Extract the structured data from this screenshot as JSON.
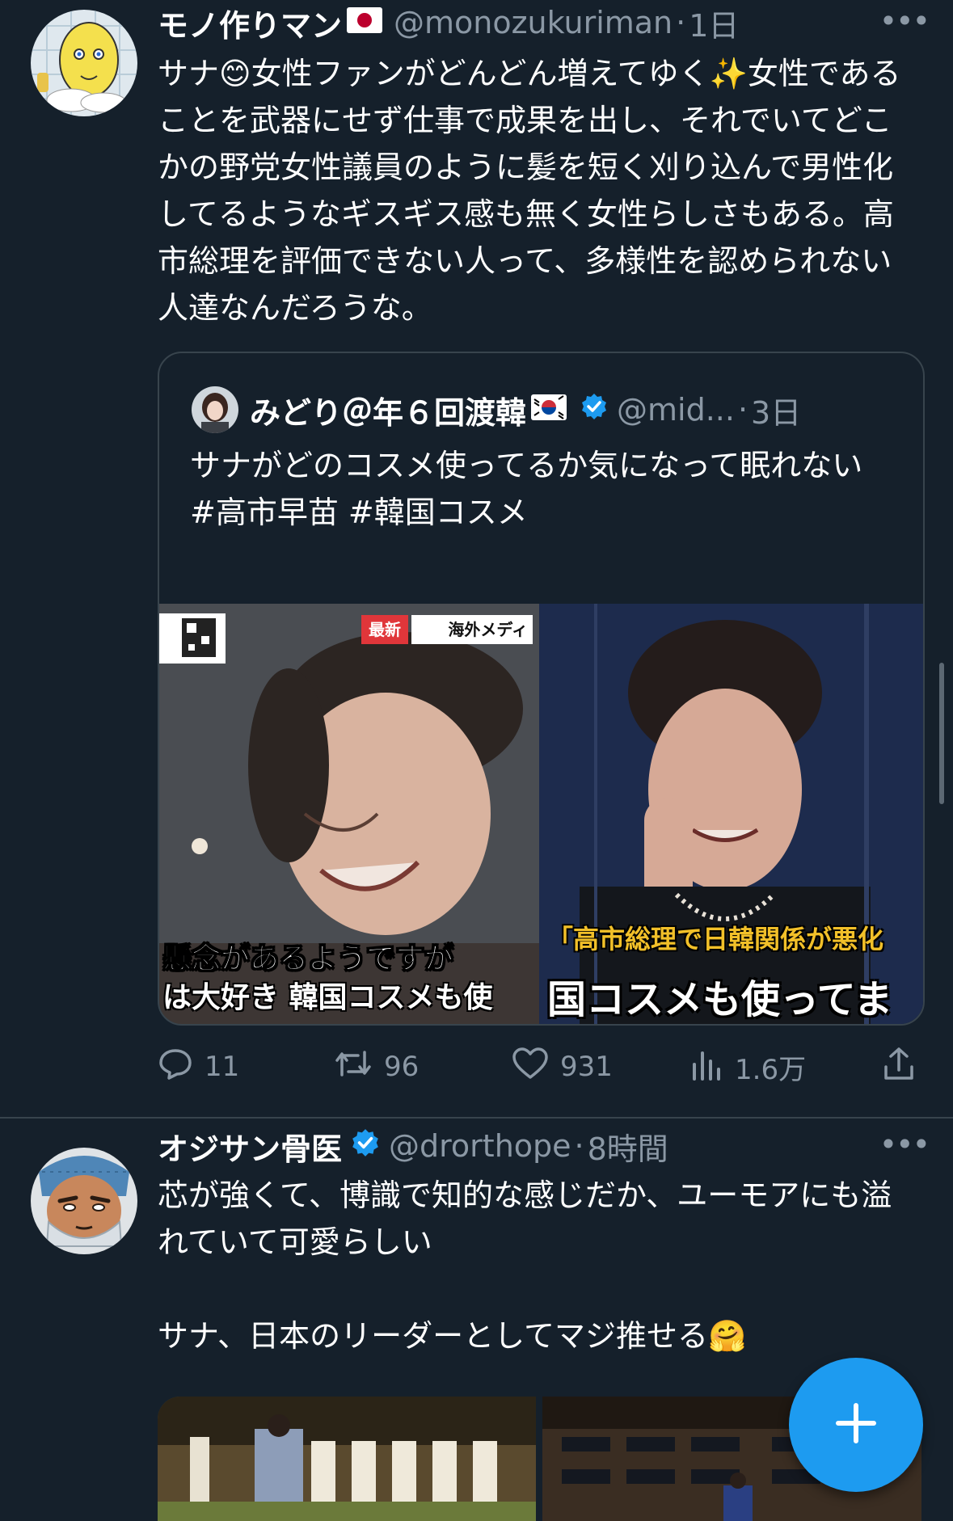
{
  "tweet1": {
    "name": "モノ作りマン",
    "handle": "@monozukuriman",
    "separator": "·",
    "time": "1日",
    "more": "•••",
    "text": "サナ😊女性ファンがどんどん増えてゆく✨女性であることを武器にせず仕事で成果を出し、それでいてどこかの野党女性議員のように髪を短く刈り込んで男性化してるようなギスギス感も無く女性らしさもある。高市総理を評価できない人って、多様性を認められない人達なんだろうな。",
    "quote": {
      "name": "みどり＠年６回渡韓",
      "handle": "@mid...",
      "separator": "·",
      "time": "3日",
      "text": "サナがどのコスメ使ってるか気になって眠れない\n#高市早苗 #韓国コスメ",
      "media": {
        "badge_new": "最新",
        "badge_overseas": "海外メディ",
        "caption_left_1": "懸念があるようですが",
        "caption_left_2": "は大好き 韓国コスメも使",
        "caption_right_1": "「高市総理で日韓関係が悪化",
        "caption_right_2": "国コスメも使ってま"
      }
    },
    "actions": {
      "replies": "11",
      "retweets": "96",
      "likes": "931",
      "views": "1.6万"
    }
  },
  "tweet2": {
    "name": "オジサン骨医",
    "handle": "@drorthope",
    "separator": "·",
    "time": "8時間",
    "more": "•••",
    "text": "芯が強くて、博識で知的な感じだか、ユーモアにも溢れていて可愛らしい\n\nサナ、日本のリーダーとしてマジ推せる🤗"
  },
  "colors": {
    "background": "#15202b",
    "secondary_text": "#8b98a5",
    "border": "#38444d",
    "accent": "#1d9bf0"
  },
  "icons": [
    "jp-flag-icon",
    "kr-flag-icon",
    "verified-badge-icon",
    "reply-icon",
    "retweet-icon",
    "like-icon",
    "views-icon",
    "share-icon",
    "compose-plus-icon"
  ]
}
